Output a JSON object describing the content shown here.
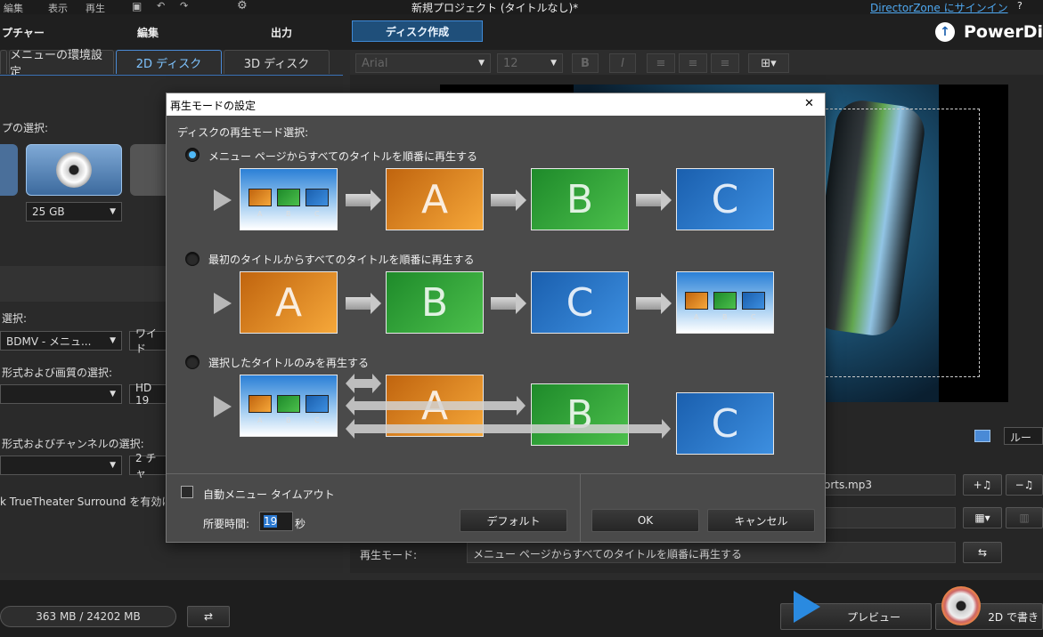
{
  "topbar": {
    "menu_edit": "編集",
    "menu_view": "表示",
    "menu_play": "再生",
    "title": "新規プロジェクト (タイトルなし)*",
    "signin": "DirectorZone にサインイン",
    "help": "?"
  },
  "modes": {
    "capture": "プチャー",
    "edit": "編集",
    "output": "出力",
    "disc": "ディスク作成",
    "brand": "PowerDi"
  },
  "tabs": {
    "menu_settings": "メニューの環境設定",
    "disc2d": "2D ディスク",
    "disc3d": "3D ディスク"
  },
  "toolbar": {
    "font": "Arial",
    "size": "12",
    "bold": "B",
    "italic": "I"
  },
  "left": {
    "disc_type_label": "プの選択:",
    "capacity": "25 GB",
    "format_label": "選択:",
    "format_value": "BDMV - メニュ...",
    "aspect_value": "ワイド",
    "video_label": "形式および画質の選択:",
    "video_value": "HD 19",
    "audio_label": "形式およびチャンネルの選択:",
    "audio_value": "2 チャ",
    "truetheater": "k TrueTheater Surround を有効に"
  },
  "right": {
    "music_file": "orts.mp3",
    "playmode_label": "再生モード:",
    "playmode_value": "メニュー ページからすべてのタイトルを順番に再生する",
    "loop_label": "ルー"
  },
  "bottom": {
    "size_info": "363 MB / 24202 MB",
    "preview": "プレビュー",
    "burn": "2D で書き"
  },
  "dialog": {
    "title": "再生モードの設定",
    "close": "✕",
    "section_label": "ディスクの再生モード選択:",
    "options": [
      {
        "label": "メニュー ページからすべてのタイトルを順番に再生する",
        "selected": true
      },
      {
        "label": "最初のタイトルからすべてのタイトルを順番に再生する",
        "selected": false
      },
      {
        "label": "選択したタイトルのみを再生する",
        "selected": false
      }
    ],
    "letters": {
      "a": "A",
      "b": "B",
      "c": "C"
    },
    "mini_labels": {
      "a": "A",
      "b": "B",
      "c": "C"
    },
    "auto_timeout_label": "自動メニュー タイムアウト",
    "duration_label": "所要時間:",
    "duration_value": "19",
    "seconds_unit": "秒",
    "default_btn": "デフォルト",
    "ok_btn": "OK",
    "cancel_btn": "キャンセル"
  },
  "colors": {
    "accent": "#4fb8f5",
    "orange": "#e8882a",
    "green": "#3aa83a",
    "blue": "#2a78d0"
  }
}
